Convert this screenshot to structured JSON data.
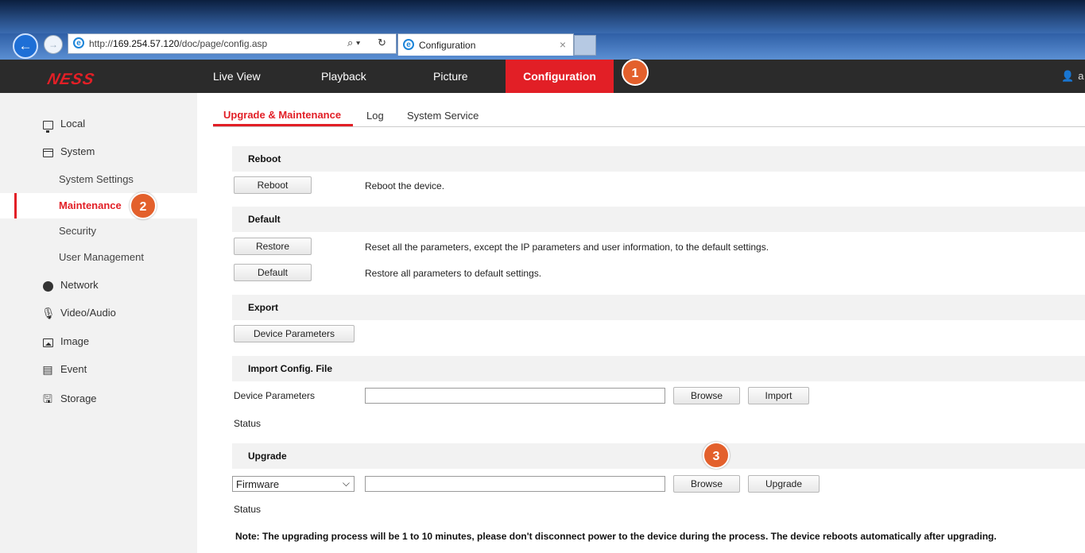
{
  "browser": {
    "url_prefix": "http://",
    "url_host": "169.254.57.120",
    "url_path": "/doc/page/config.asp",
    "search_icon": "⌕ ▾",
    "refresh_icon": "↻",
    "tab_title": "Configuration",
    "tab_close": "×"
  },
  "topnav": {
    "logo": "NESS",
    "items": [
      "Live View",
      "Playback",
      "Picture",
      "Configuration"
    ],
    "user_initial": "a"
  },
  "callouts": [
    "1",
    "2",
    "3"
  ],
  "sidebar": {
    "items": [
      {
        "label": "Local",
        "icon": "monitor-icon"
      },
      {
        "label": "System",
        "icon": "window-icon"
      },
      {
        "label": "System Settings"
      },
      {
        "label": "Maintenance"
      },
      {
        "label": "Security"
      },
      {
        "label": "User Management"
      },
      {
        "label": "Network",
        "icon": "globe-icon"
      },
      {
        "label": "Video/Audio",
        "icon": "mic-gear-icon"
      },
      {
        "label": "Image",
        "icon": "image-icon"
      },
      {
        "label": "Event",
        "icon": "calendar-icon"
      },
      {
        "label": "Storage",
        "icon": "floppy-icon"
      }
    ]
  },
  "subtabs": [
    "Upgrade & Maintenance",
    "Log",
    "System Service"
  ],
  "reboot": {
    "header": "Reboot",
    "button": "Reboot",
    "desc": "Reboot the device."
  },
  "default": {
    "header": "Default",
    "restore_button": "Restore",
    "restore_desc": "Reset all the parameters, except the IP parameters and user information, to the default settings.",
    "default_button": "Default",
    "default_desc": "Restore all parameters to default settings."
  },
  "export": {
    "header": "Export",
    "button": "Device Parameters"
  },
  "import": {
    "header": "Import Config. File",
    "label": "Device Parameters",
    "path_value": "",
    "browse": "Browse",
    "import": "Import",
    "status_label": "Status"
  },
  "upgrade": {
    "header": "Upgrade",
    "type_selected": "Firmware",
    "path_value": "",
    "browse": "Browse",
    "upgrade": "Upgrade",
    "status_label": "Status",
    "note": "Note: The upgrading process will be 1 to 10 minutes, please don't disconnect power to the device during the process. The device reboots automatically after upgrading."
  },
  "colors": {
    "accent": "#e21f26",
    "callout": "#e3602c",
    "nav_bg": "#2b2b2b",
    "sidebar_bg": "#f2f2f2"
  }
}
